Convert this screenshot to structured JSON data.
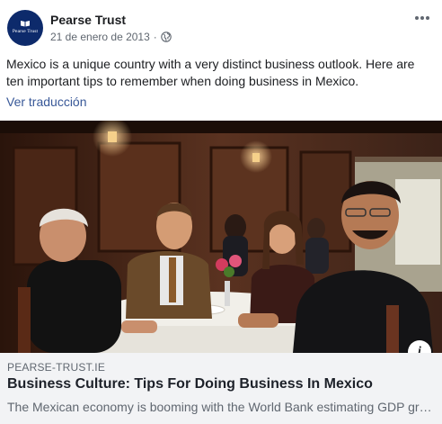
{
  "post": {
    "page_name": "Pearse Trust",
    "avatar_text": "Pearse Trust",
    "date": "21 de enero de 2013",
    "separator": "·",
    "audience_icon": "globe-icon",
    "more_icon": "more-options-icon",
    "text": "Mexico is a unique country with a very distinct business outlook. Here are ten important tips to remember when doing business in Mexico.",
    "translate_label": "Ver traducción"
  },
  "link": {
    "info_label": "i",
    "domain": "PEARSE-TRUST.IE",
    "title": "Business Culture: Tips For Doing Business In Mexico",
    "description": "The Mexican economy is booming with the World Bank estimating GDP growth in Mexico..."
  },
  "colors": {
    "link_blue": "#385898",
    "avatar_bg": "#0d2a6b",
    "caption_bg": "#f2f3f5",
    "secondary_text": "#606770"
  }
}
